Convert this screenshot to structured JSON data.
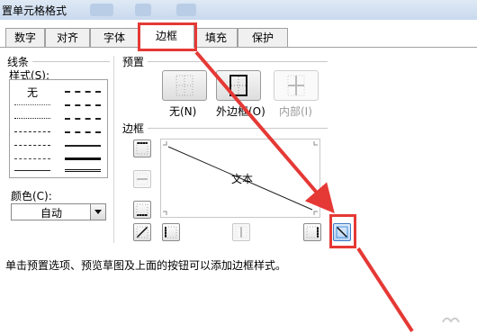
{
  "dialog": {
    "title": "置单元格格式"
  },
  "tabs": [
    {
      "label": "数字"
    },
    {
      "label": "对齐"
    },
    {
      "label": "字体"
    },
    {
      "label": "边框",
      "active": true
    },
    {
      "label": "填充"
    },
    {
      "label": "保护"
    }
  ],
  "line_section": {
    "label": "线条",
    "style_label": "样式(S):",
    "none_label": "无",
    "color_label": "颜色(C):",
    "color_value": "自动"
  },
  "presets": {
    "label": "预置",
    "items": [
      {
        "label": "无(N)"
      },
      {
        "label": "外边框(O)"
      },
      {
        "label": "内部(I)"
      }
    ]
  },
  "border_section": {
    "label": "边框",
    "preview_text": "文本"
  },
  "hint": "单击预置选项、预览草图及上面的按钮可以添加边框样式。",
  "colors": {
    "highlight": "#e53935",
    "accent": "#4a90d9"
  }
}
